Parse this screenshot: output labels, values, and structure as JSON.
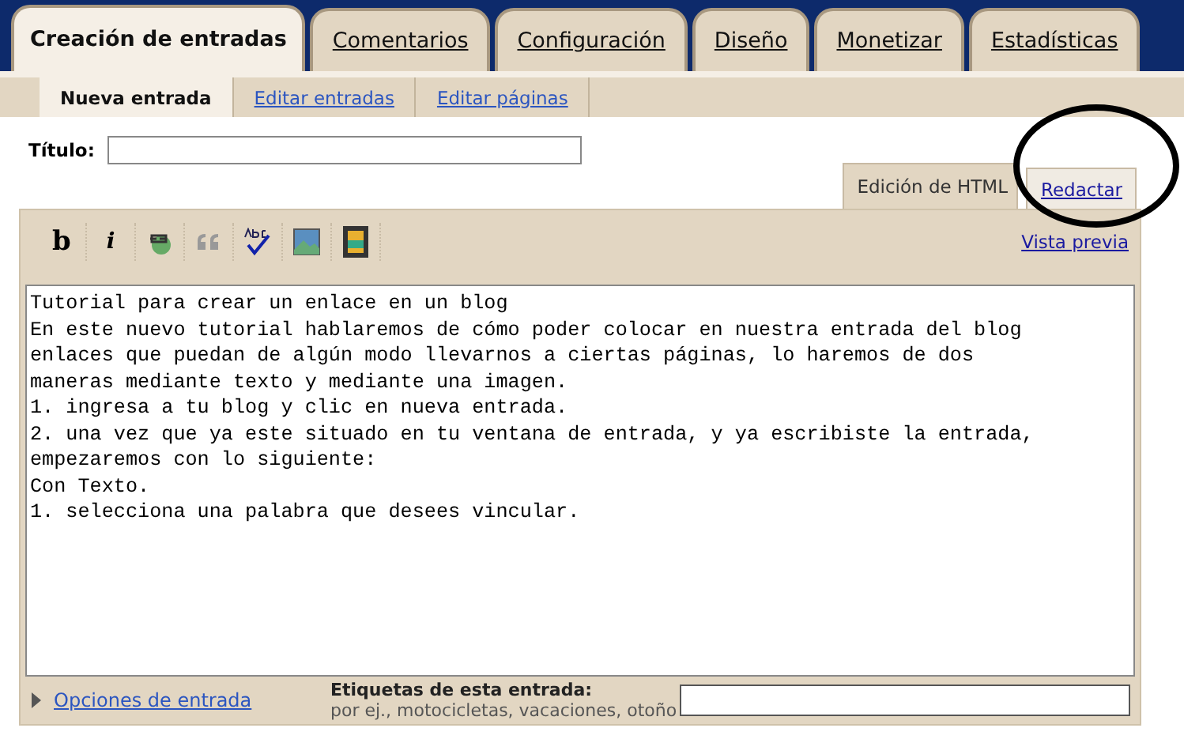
{
  "main_tabs": [
    {
      "label": "Creación de entradas",
      "selected": true
    },
    {
      "label": "Comentarios",
      "selected": false
    },
    {
      "label": "Configuración",
      "selected": false
    },
    {
      "label": "Diseño",
      "selected": false
    },
    {
      "label": "Monetizar",
      "selected": false
    },
    {
      "label": "Estadísticas",
      "selected": false
    }
  ],
  "sub_tabs": [
    {
      "label": "Nueva entrada",
      "selected": true
    },
    {
      "label": "Editar entradas",
      "selected": false
    },
    {
      "label": "Editar páginas",
      "selected": false
    }
  ],
  "title_field": {
    "label": "Título:"
  },
  "editor_modes": [
    {
      "label": "Edición de HTML",
      "selected": true
    },
    {
      "label": "Redactar",
      "selected": false
    }
  ],
  "toolbar": [
    {
      "kind": "bold",
      "label": "b"
    },
    {
      "kind": "italic",
      "label": "i"
    },
    {
      "kind": "link"
    },
    {
      "kind": "quote"
    },
    {
      "kind": "spellcheck"
    },
    {
      "kind": "image"
    },
    {
      "kind": "video"
    }
  ],
  "preview_link": "Vista previa",
  "editor_lines": [
    "Tutorial para crear un enlace en un blog",
    "En este nuevo tutorial hablaremos de cómo poder colocar en nuestra entrada del blog",
    "enlaces que puedan de algún modo llevarnos a ciertas páginas, lo haremos de dos",
    "maneras mediante texto y mediante una imagen.",
    "1. ingresa a tu blog y clic en nueva entrada.",
    "2. una vez que ya este situado en tu ventana de entrada, y ya escribiste la entrada,",
    "empezaremos con lo siguiente:",
    "Con Texto.",
    "1. selecciona una palabra que desees vincular."
  ],
  "post_options": {
    "label": "Opciones de entrada",
    "expanded": false
  },
  "labels_field": {
    "label": "Etiquetas de esta entrada:",
    "hint": "por ej., motocicletas, vacaciones, otoño"
  }
}
